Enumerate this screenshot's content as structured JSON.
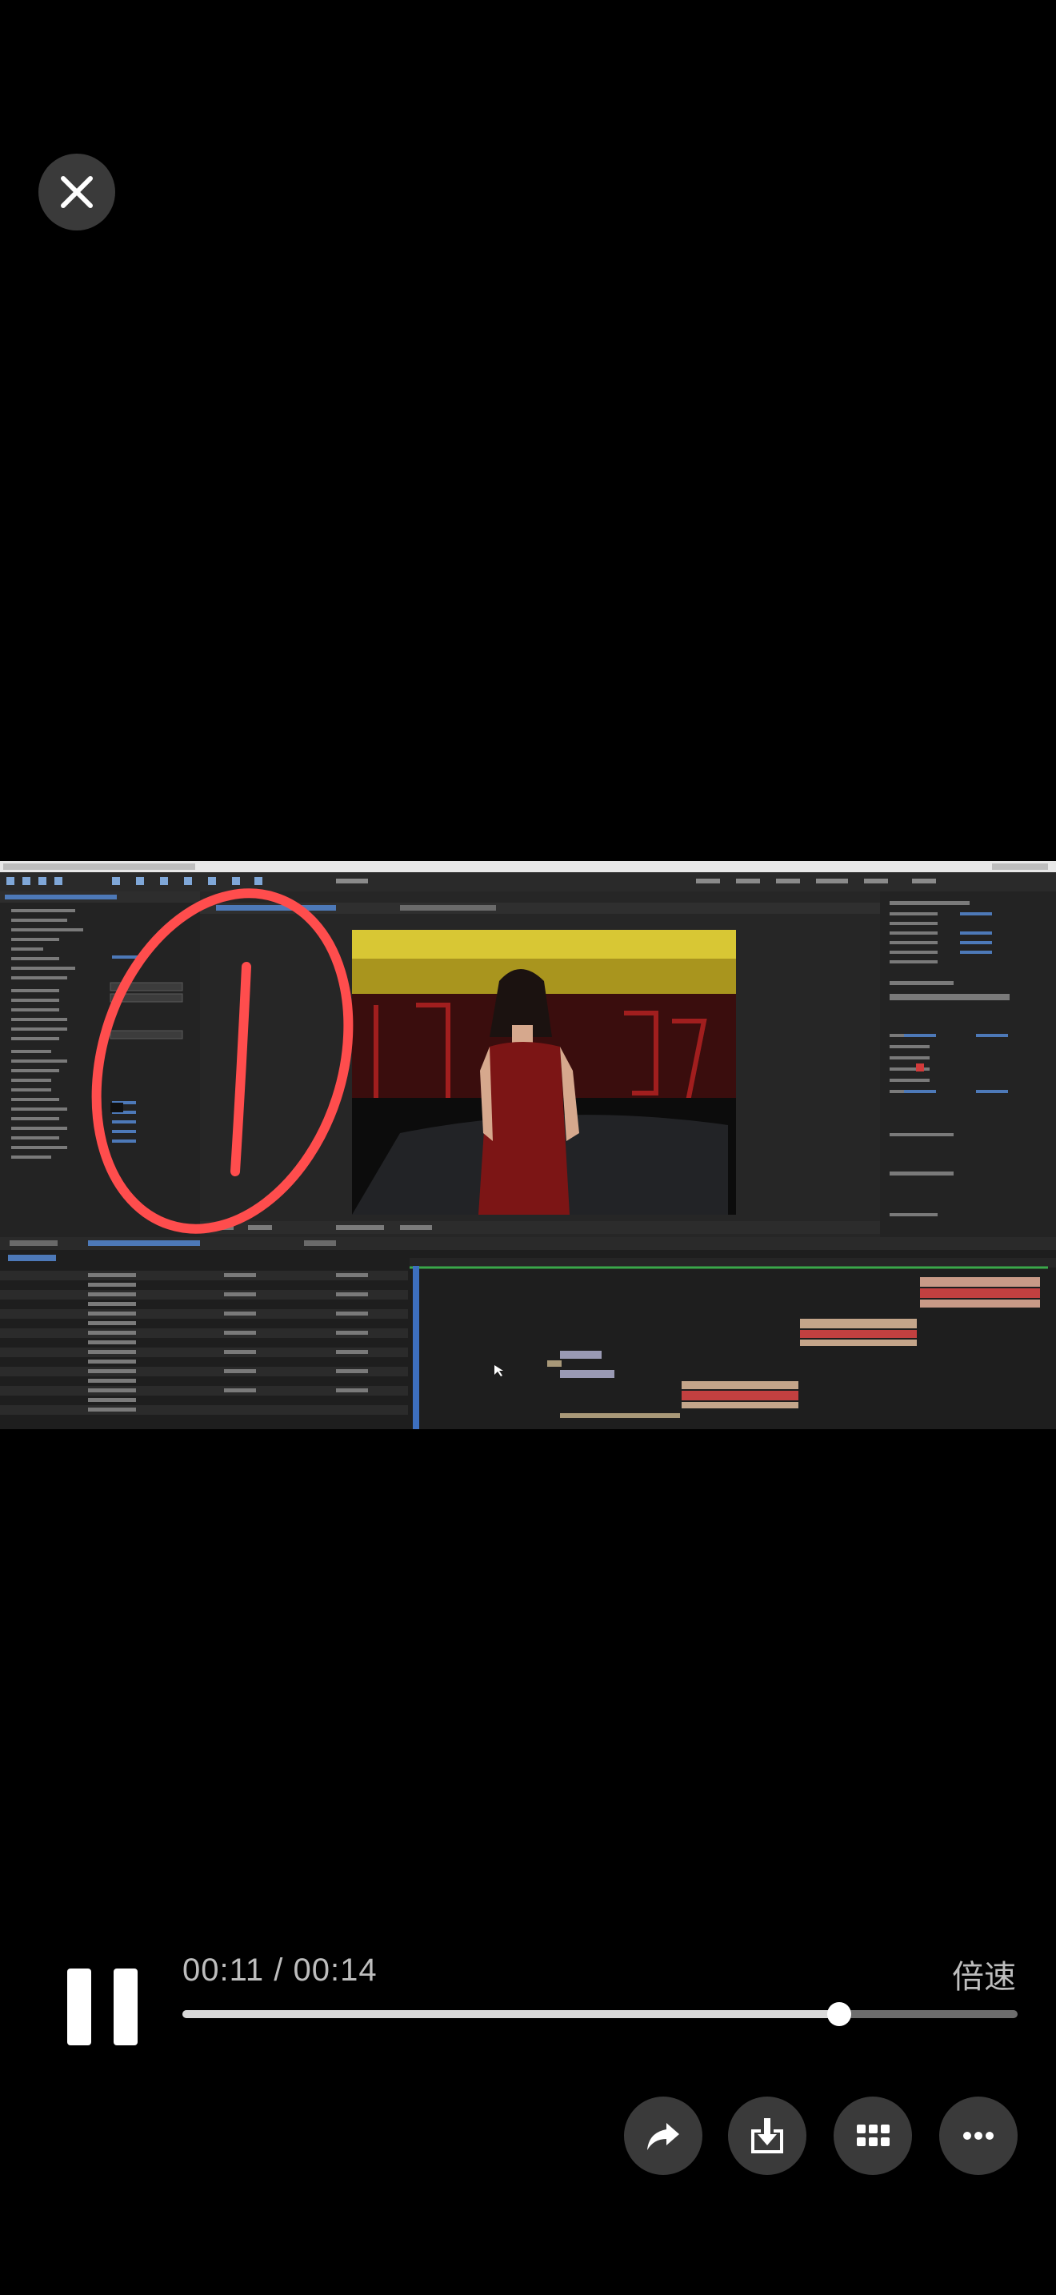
{
  "player": {
    "current_time": "00:11",
    "total_time": "00:14",
    "time_separator": " / ",
    "progress": 0.786,
    "speed_label": "倍速"
  },
  "icons": {
    "close": "close-icon",
    "pause": "pause-icon",
    "share": "share-icon",
    "download": "download-icon",
    "grid": "grid-icon",
    "more": "more-icon"
  },
  "colors": {
    "background": "#000000",
    "button_bg": "#3a3a3a",
    "annotation": "#ff4d4d",
    "progress_track": "#6d6d6d",
    "progress_fill": "#d9d9d9"
  }
}
